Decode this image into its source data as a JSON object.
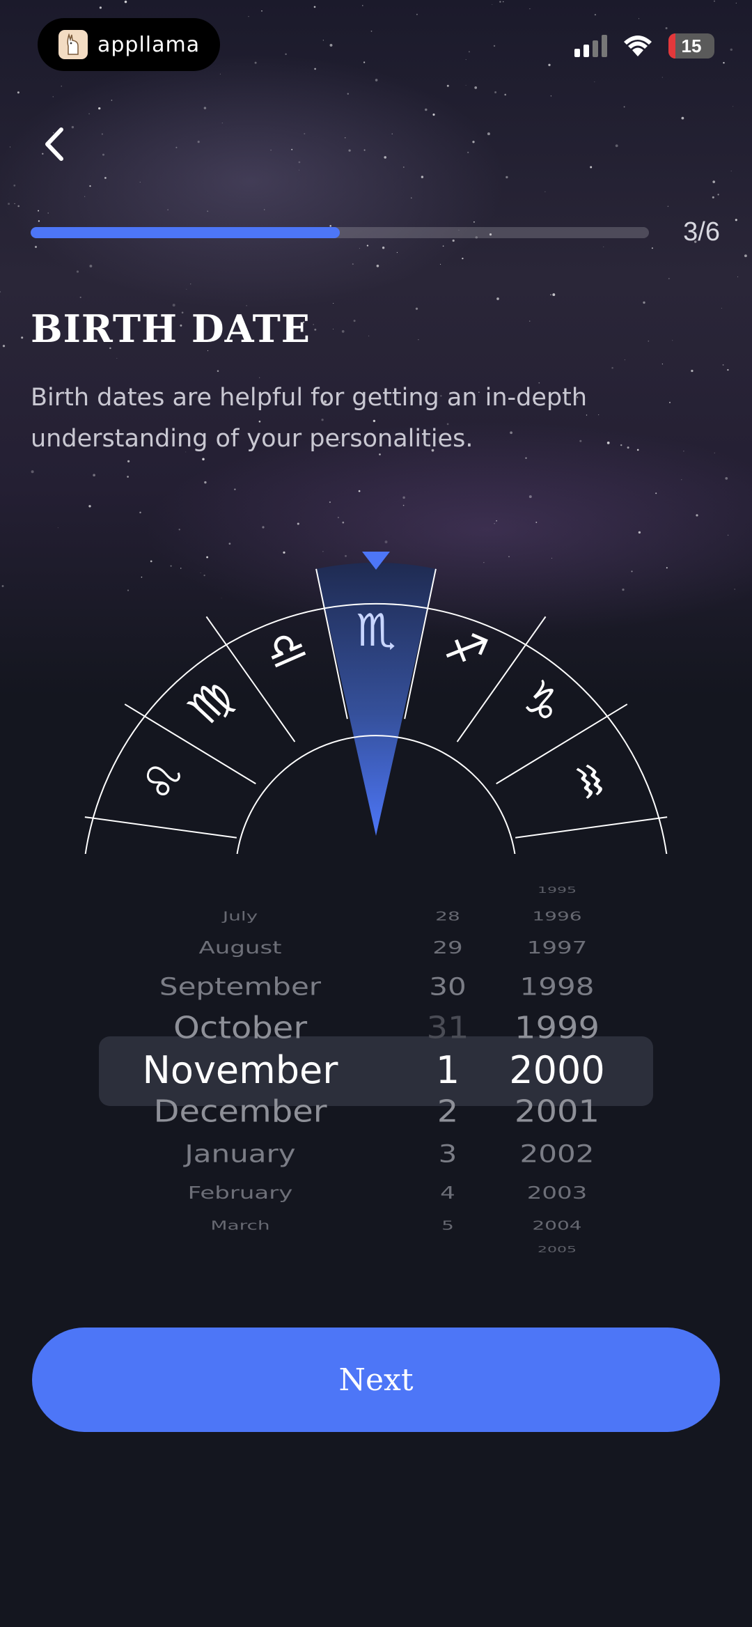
{
  "status_bar": {
    "app_name": "appllama",
    "battery": "15",
    "battery_color": "#e3383b"
  },
  "nav": {
    "back_icon": "chevron-left-icon"
  },
  "progress": {
    "label": "3/6",
    "fraction": 0.5,
    "color": "#4d76f7"
  },
  "header": {
    "title": "BIRTH DATE",
    "description": "Birth dates are helpful for getting an in-depth understanding of your personalities."
  },
  "zodiac_wheel": {
    "selected": "♏",
    "signs": [
      "♋",
      "♌",
      "♍",
      "♎",
      "♏",
      "♐",
      "♑",
      "♒"
    ]
  },
  "picker": {
    "months": [
      "July",
      "August",
      "September",
      "October",
      "November",
      "December",
      "January",
      "February",
      "March"
    ],
    "days": [
      "28",
      "29",
      "30",
      "31",
      "1",
      "2",
      "3",
      "4",
      "5"
    ],
    "years": [
      "1995",
      "1996",
      "1997",
      "1998",
      "1999",
      "2000",
      "2001",
      "2002",
      "2003",
      "2004",
      "2005"
    ],
    "selected": {
      "month": "November",
      "day": "1",
      "year": "2000"
    }
  },
  "next_button": {
    "label": "Next"
  },
  "colors": {
    "accent": "#4d76f7",
    "background": "#14161f"
  }
}
